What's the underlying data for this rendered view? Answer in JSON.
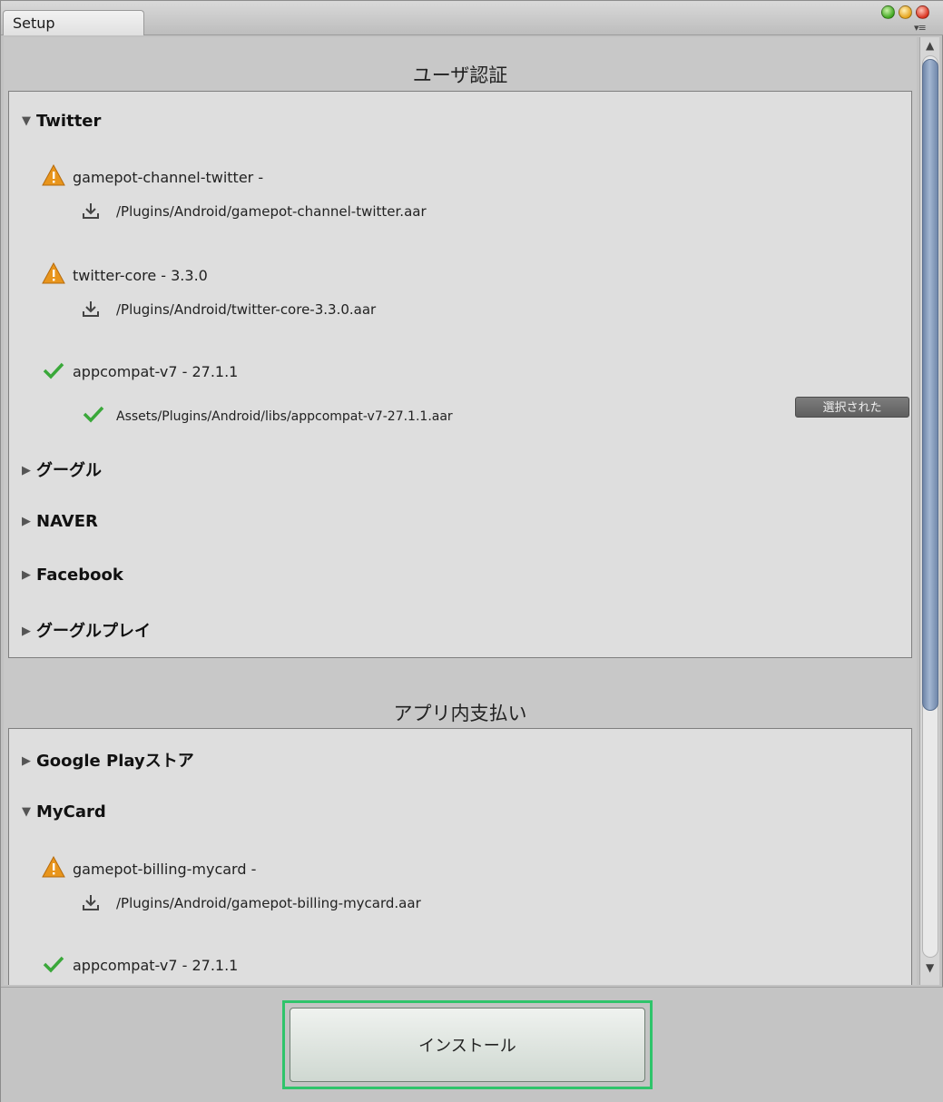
{
  "window": {
    "tab_label": "Setup"
  },
  "auth": {
    "title": "ユーザ認証",
    "twitter": {
      "label": "Twitter",
      "items": [
        {
          "name": "gamepot-channel-twitter -",
          "path": "/Plugins/Android/gamepot-channel-twitter.aar"
        },
        {
          "name": "twitter-core - 3.3.0",
          "path": "/Plugins/Android/twitter-core-3.3.0.aar"
        },
        {
          "name": "appcompat-v7 - 27.1.1",
          "path": "Assets/Plugins/Android/libs/appcompat-v7-27.1.1.aar",
          "badge": "選択された"
        }
      ]
    },
    "google": "グーグル",
    "naver": "NAVER",
    "facebook": "Facebook",
    "googleplay": "グーグルプレイ"
  },
  "iap": {
    "title": "アプリ内支払い",
    "playstore": "Google Playストア",
    "mycard": {
      "label": "MyCard",
      "items": [
        {
          "name": "gamepot-billing-mycard -",
          "path": "/Plugins/Android/gamepot-billing-mycard.aar"
        },
        {
          "name": "appcompat-v7 - 27.1.1"
        }
      ]
    }
  },
  "install_label": "インストール",
  "colors": {
    "warning": "#e8951c",
    "check": "#3aa83a",
    "install_highlight": "#2fc46b",
    "scroll_thumb": "#8ca0bf"
  }
}
